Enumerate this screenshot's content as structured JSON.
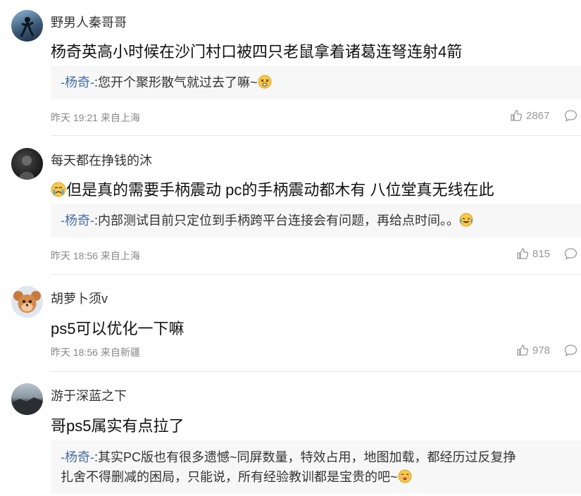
{
  "comments": [
    {
      "username": "野男人秦哥哥",
      "content": "杨奇英高小时候在沙门村口被四只老鼠拿着诸葛连弩连射4箭",
      "reply": {
        "author": "-杨奇-",
        "sep": ":",
        "text": "您开个聚形散气就过去了嘛~"
      },
      "time": "昨天 19:21",
      "location": "来自上海",
      "likes": "2867"
    },
    {
      "username": "每天都在挣钱的沐",
      "content": "但是真的需要手柄震动 pc的手柄震动都木有 八位堂真无线在此",
      "reply": {
        "author": "-杨奇-",
        "sep": ":",
        "text": "内部测试目前只定位到手柄跨平台连接会有问题，再给点时间。。"
      },
      "time": "昨天 18:56",
      "location": "来自上海",
      "likes": "815"
    },
    {
      "username": "胡萝卜须v",
      "content": "ps5可以优化一下嘛",
      "time": "昨天 18:56",
      "location": "来自新疆",
      "likes": "978"
    },
    {
      "username": "游于深蓝之下",
      "content": "哥ps5属实有点拉了",
      "reply": {
        "author": "-杨奇-",
        "sep": ":",
        "text_line1": "其实PC版也有很多遗憾~同屏数量，特效占用，地图加载，都经历过反复挣",
        "text_line2": "扎舍不得删减的困局，只能说，所有经验教训都是宝贵的吧~"
      }
    }
  ],
  "colors": {
    "reply_author": "#4a6fa5",
    "reply_bg": "#f7f7f7",
    "meta": "#888888"
  },
  "icons": [
    "like-icon",
    "comment-icon",
    "dizzy-emoji",
    "crying-emoji",
    "laughing-crying-emoji",
    "blush-emoji"
  ]
}
